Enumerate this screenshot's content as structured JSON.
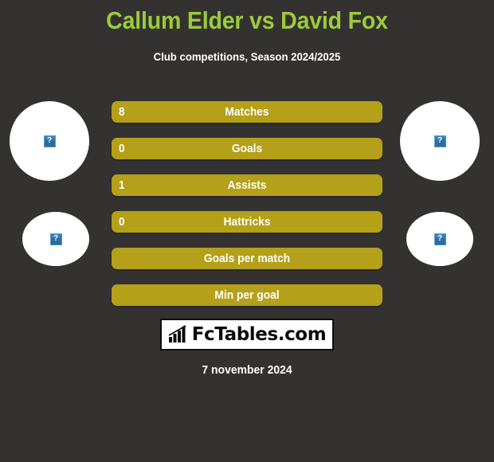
{
  "header": {
    "title": "Callum Elder vs David Fox",
    "subtitle": "Club competitions, Season 2024/2025",
    "title_color": "#9ccb3b",
    "subtitle_color": "#ffffff"
  },
  "theme": {
    "background": "#333231",
    "bar_color": "#b5a019",
    "bar_text": "#ffffff",
    "avatar_background": "#ffffff"
  },
  "players": {
    "left": {
      "name": "Callum Elder",
      "photo_top": "broken-image-placeholder",
      "photo_bottom": "broken-image-placeholder",
      "placeholder_glyph": "?"
    },
    "right": {
      "name": "David Fox",
      "photo_top": "broken-image-placeholder",
      "photo_bottom": "broken-image-placeholder",
      "placeholder_glyph": "?"
    }
  },
  "chart_data": {
    "type": "bar",
    "title": "Callum Elder vs David Fox",
    "subtitle": "Club competitions, Season 2024/2025",
    "xlabel": "",
    "ylabel": "",
    "orientation": "horizontal",
    "legend": [],
    "categories": [
      "Matches",
      "Goals",
      "Assists",
      "Hattricks",
      "Goals per match",
      "Min per goal"
    ],
    "series": [
      {
        "name": "Callum Elder",
        "values": [
          "8",
          "0",
          "1",
          "0",
          "",
          ""
        ]
      }
    ],
    "rows": [
      {
        "label": "Matches",
        "value": "8"
      },
      {
        "label": "Goals",
        "value": "0"
      },
      {
        "label": "Assists",
        "value": "1"
      },
      {
        "label": "Hattricks",
        "value": "0"
      },
      {
        "label": "Goals per match",
        "value": ""
      },
      {
        "label": "Min per goal",
        "value": ""
      }
    ]
  },
  "watermark": {
    "text": "FcTables.com",
    "icon": "bar-chart-growth-icon"
  },
  "footer": {
    "date": "7 november 2024"
  }
}
